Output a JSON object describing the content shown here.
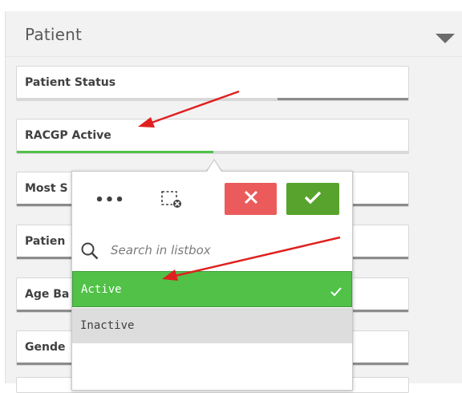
{
  "panel": {
    "title": "Patient",
    "collapse_icon": "caret-down-icon"
  },
  "filters": [
    {
      "label": "Patient Status"
    },
    {
      "label": "RACGP Active"
    },
    {
      "label": "Most S"
    },
    {
      "label": "Patien"
    },
    {
      "label": "Age Ba"
    },
    {
      "label": "Gende"
    }
  ],
  "listbox": {
    "more_label": "•••",
    "search_placeholder": "Search in listbox",
    "items": [
      {
        "label": "Active",
        "selected": true
      },
      {
        "label": "Inactive",
        "selected": false
      }
    ],
    "icons": {
      "more": "more-options-icon",
      "clear": "clear-selection-icon",
      "cancel": "close-icon",
      "confirm": "check-icon",
      "search": "search-icon"
    }
  },
  "colors": {
    "selected_green": "#51c148",
    "confirm_green": "#58a32d",
    "cancel_red": "#eb5b5b",
    "annotation_red": "#e02020",
    "excluded_gray": "#dddddd"
  },
  "annotations": [
    "arrow-to-racgp-active",
    "arrow-to-active-item"
  ]
}
